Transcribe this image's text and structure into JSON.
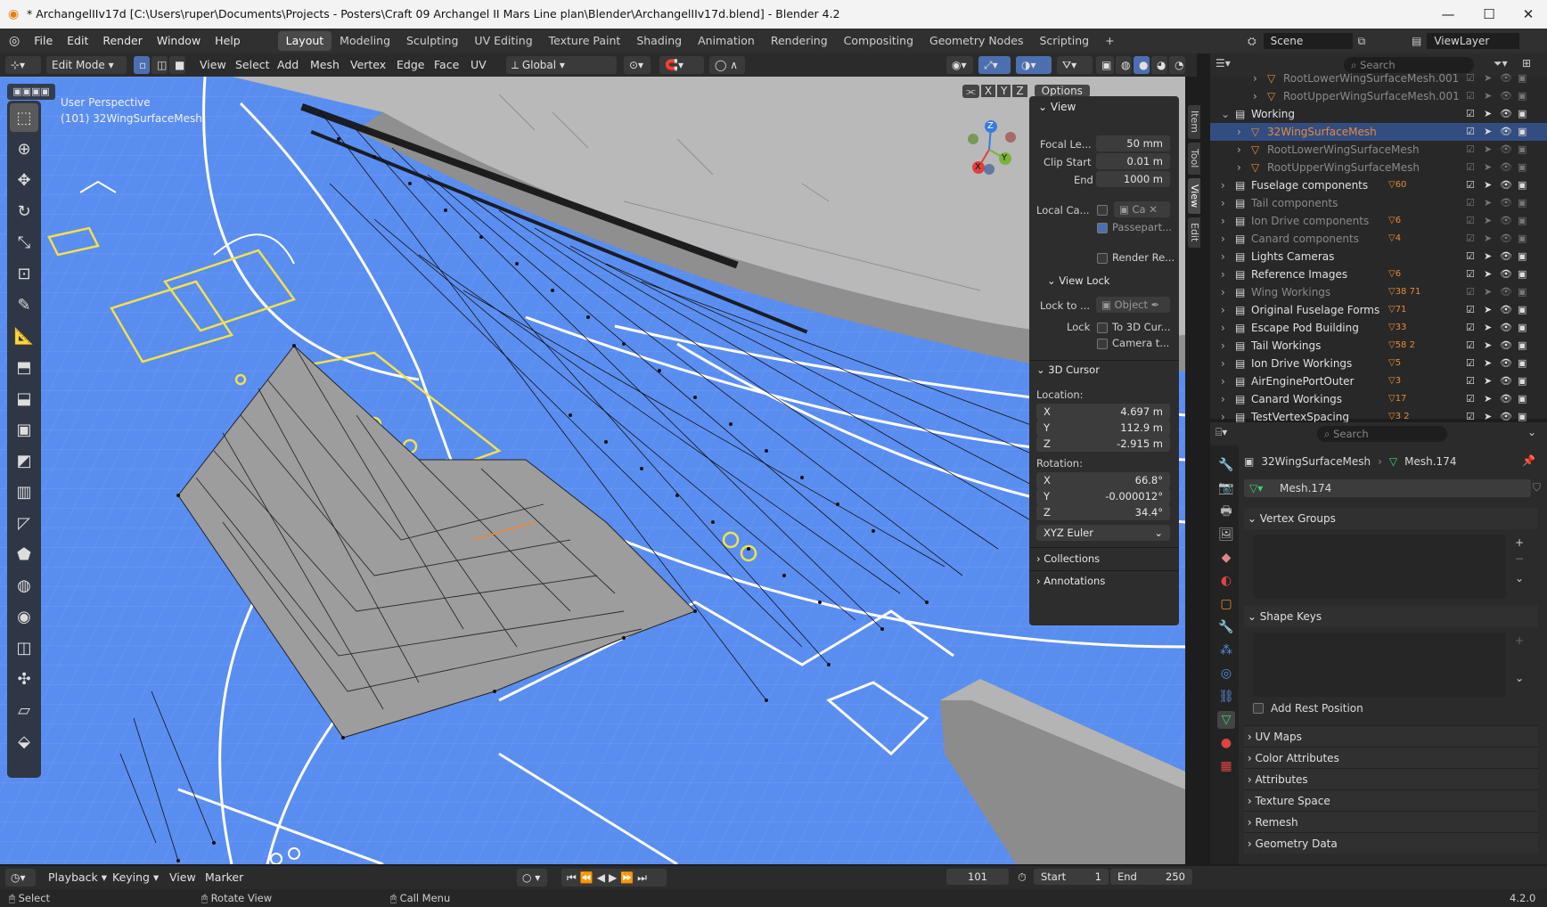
{
  "window": {
    "title": "* ArchangelIIv17d [C:\\Users\\ruper\\Documents\\Projects - Posters\\Craft 09 Archangel II Mars Line plan\\Blender\\ArchangelIIv17d.blend] - Blender 4.2"
  },
  "menus": [
    "File",
    "Edit",
    "Render",
    "Window",
    "Help"
  ],
  "workspaces": [
    "Layout",
    "Modeling",
    "Sculpting",
    "UV Editing",
    "Texture Paint",
    "Shading",
    "Animation",
    "Rendering",
    "Compositing",
    "Geometry Nodes",
    "Scripting"
  ],
  "active_workspace": "Layout",
  "scene": {
    "name": "Scene",
    "view_layer": "ViewLayer"
  },
  "header": {
    "mode": "Edit Mode",
    "menus": [
      "View",
      "Select",
      "Add",
      "Mesh",
      "Vertex",
      "Edge",
      "Face",
      "UV"
    ],
    "transform_orientation": "Global",
    "options": "Options",
    "axes": [
      "X",
      "Y",
      "Z"
    ]
  },
  "viewport": {
    "perspective": "User Perspective",
    "object_label": "(101) 32WingSurfaceMesh"
  },
  "gizmo": {
    "x": "X",
    "y": "Y",
    "z": "Z"
  },
  "npanel": {
    "tabs": [
      "Item",
      "Tool",
      "View",
      "Edit"
    ],
    "view": {
      "title": "View",
      "focal_length_label": "Focal Le...",
      "focal_length": "50 mm",
      "clip_start_label": "Clip Start",
      "clip_start": "0.01 m",
      "end_label": "End",
      "clip_end": "1000 m",
      "local_camera_label": "Local Ca...",
      "local_camera_value": "Ca",
      "passepartout": "Passepart...",
      "render_region": "Render Re..."
    },
    "view_lock": {
      "title": "View Lock",
      "lock_to_label": "Lock to ...",
      "lock_to_value": "Object",
      "lock_label": "Lock",
      "to_3d_cursor": "To 3D Cur...",
      "camera_to_view": "Camera t..."
    },
    "cursor": {
      "title": "3D Cursor",
      "location_label": "Location:",
      "loc": [
        {
          "axis": "X",
          "value": "4.697 m"
        },
        {
          "axis": "Y",
          "value": "112.9 m"
        },
        {
          "axis": "Z",
          "value": "-2.915 m"
        }
      ],
      "rotation_label": "Rotation:",
      "rot": [
        {
          "axis": "X",
          "value": "66.8°"
        },
        {
          "axis": "Y",
          "value": "-0.000012°"
        },
        {
          "axis": "Z",
          "value": "34.4°"
        }
      ],
      "rotation_mode": "XYZ Euler"
    },
    "collections": "Collections",
    "annotations": "Annotations"
  },
  "outliner": {
    "search_placeholder": "Search",
    "rows": [
      {
        "name": "RootLowerWingSurfaceMesh.001",
        "indent": 3,
        "dim": true,
        "badge": ""
      },
      {
        "name": "RootUpperWingSurfaceMesh.001",
        "indent": 3,
        "dim": true,
        "badge": ""
      },
      {
        "name": "Working",
        "indent": 1,
        "dim": false,
        "badge": ""
      },
      {
        "name": "32WingSurfaceMesh",
        "indent": 2,
        "dim": false,
        "badge": "",
        "selected": true
      },
      {
        "name": "RootLowerWingSurfaceMesh",
        "indent": 2,
        "dim": true,
        "badge": ""
      },
      {
        "name": "RootUpperWingSurfaceMesh",
        "indent": 2,
        "dim": true,
        "badge": ""
      },
      {
        "name": "Fuselage components",
        "indent": 1,
        "dim": false,
        "badge": "60"
      },
      {
        "name": "Tail components",
        "indent": 1,
        "dim": true,
        "badge": ""
      },
      {
        "name": "Ion Drive components",
        "indent": 1,
        "dim": true,
        "badge": "6"
      },
      {
        "name": "Canard components",
        "indent": 1,
        "dim": true,
        "badge": "4"
      },
      {
        "name": "Lights Cameras",
        "indent": 1,
        "dim": false,
        "badge": ""
      },
      {
        "name": "Reference Images",
        "indent": 1,
        "dim": false,
        "badge": "6"
      },
      {
        "name": "Wing Workings",
        "indent": 1,
        "dim": true,
        "badge": "38 71"
      },
      {
        "name": "Original Fuselage Forms",
        "indent": 1,
        "dim": false,
        "badge": "71"
      },
      {
        "name": "Escape Pod Building",
        "indent": 1,
        "dim": false,
        "badge": "33"
      },
      {
        "name": "Tail Workings",
        "indent": 1,
        "dim": false,
        "badge": "58 2"
      },
      {
        "name": "Ion Drive Workings",
        "indent": 1,
        "dim": false,
        "badge": "5"
      },
      {
        "name": "AirEnginePortOuter",
        "indent": 1,
        "dim": false,
        "badge": "3"
      },
      {
        "name": "Canard Workings",
        "indent": 1,
        "dim": false,
        "badge": "17"
      },
      {
        "name": "TestVertexSpacing",
        "indent": 1,
        "dim": false,
        "badge": "3 2"
      }
    ]
  },
  "properties": {
    "search_placeholder": "Search",
    "object": "32WingSurfaceMesh",
    "mesh": "Mesh.174",
    "datablock": "Mesh.174",
    "sections": {
      "vertex_groups": "Vertex Groups",
      "shape_keys": "Shape Keys",
      "add_rest_position": "Add Rest Position",
      "collapsed": [
        "UV Maps",
        "Color Attributes",
        "Attributes",
        "Texture Space",
        "Remesh",
        "Geometry Data"
      ]
    }
  },
  "timeline": {
    "menus": [
      "Playback",
      "Keying",
      "View",
      "Marker"
    ],
    "current_frame": "101",
    "start_label": "Start",
    "start": "1",
    "end_label": "End",
    "end": "250"
  },
  "statusbar": {
    "select": "Select",
    "rotate": "Rotate View",
    "menu": "Call Menu",
    "version": "4.2.0"
  },
  "colors": {
    "viewport_bg": "#5a8df0",
    "accent": "#e8893a",
    "selected_row": "#334d80"
  }
}
